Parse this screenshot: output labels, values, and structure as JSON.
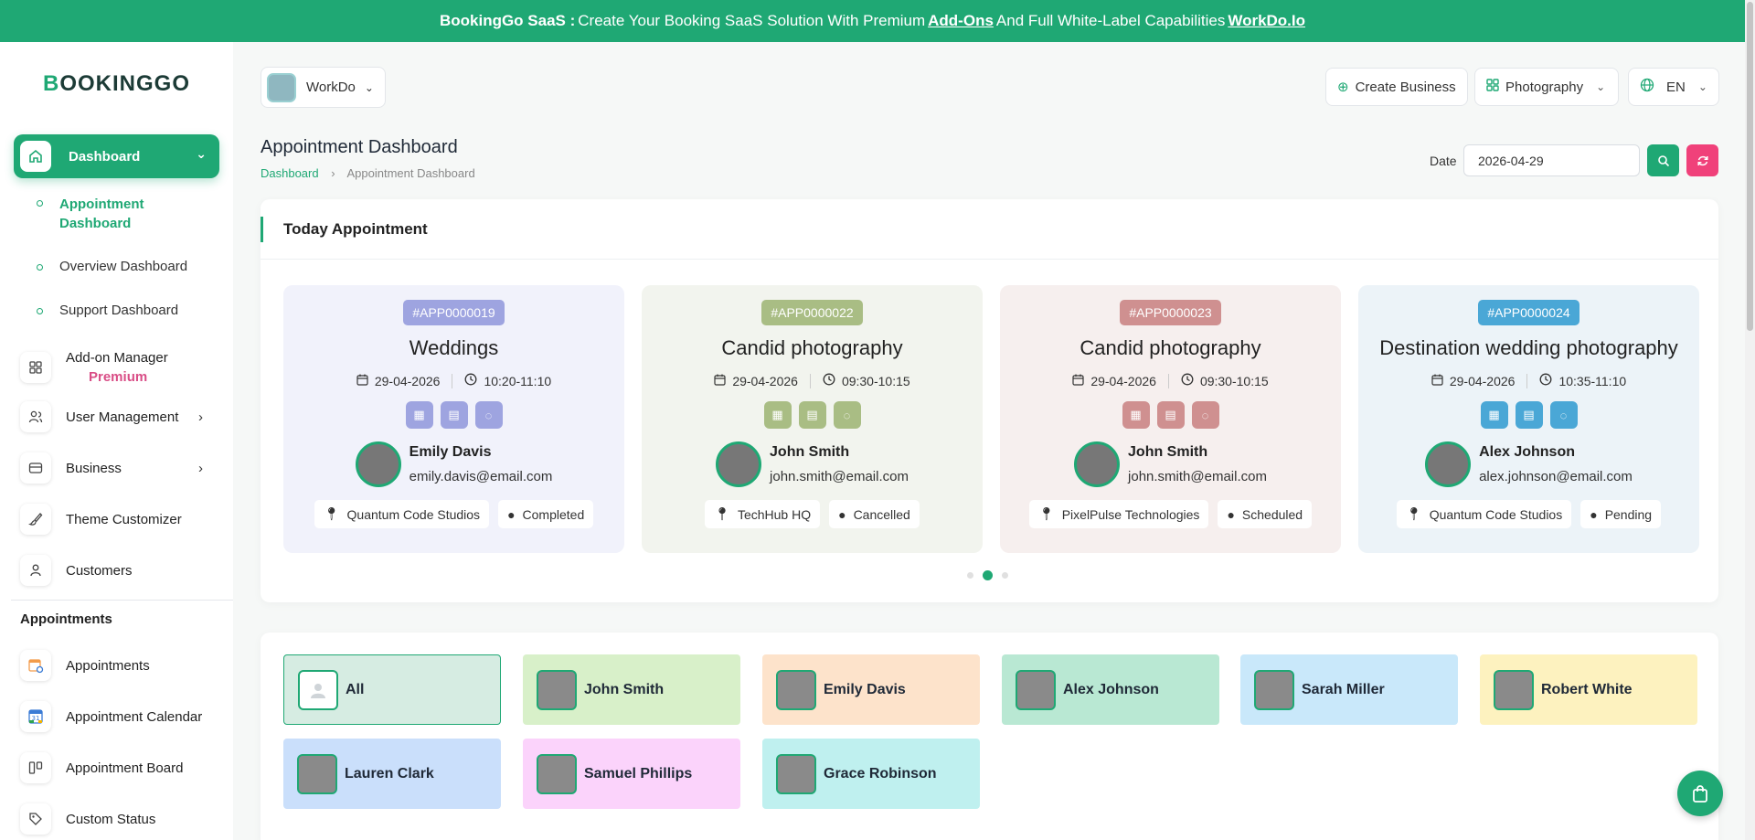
{
  "banner": {
    "brand": "BookingGo SaaS :",
    "text1": "Create Your Booking SaaS Solution With Premium",
    "link1": "Add-Ons",
    "text2": "And Full White-Label Capabilities",
    "link2": "WorkDo.Io"
  },
  "logo": {
    "first": "B",
    "rest": "OOKINGGO"
  },
  "sidebar": {
    "dashboard_label": "Dashboard",
    "sub_items": [
      "Appointment Dashboard",
      "Overview Dashboard",
      "Support Dashboard"
    ],
    "items": [
      {
        "label": "Add-on Manager",
        "badge": "Premium",
        "icon": "grid-icon"
      },
      {
        "label": "User Management",
        "icon": "users-icon"
      },
      {
        "label": "Business",
        "icon": "business-icon"
      },
      {
        "label": "Theme Customizer",
        "icon": "brush-icon"
      },
      {
        "label": "Customers",
        "icon": "user-icon"
      }
    ],
    "section": "Appointments",
    "appointment_items": [
      {
        "label": "Appointments",
        "icon": "appointments-icon"
      },
      {
        "label": "Appointment Calendar",
        "icon": "calendar-icon"
      },
      {
        "label": "Appointment Board",
        "icon": "board-icon"
      },
      {
        "label": "Custom Status",
        "icon": "tag-icon"
      }
    ]
  },
  "header": {
    "workspace": "WorkDo",
    "create_business": "Create Business",
    "category": "Photography",
    "language": "EN"
  },
  "page": {
    "title": "Appointment Dashboard",
    "breadcrumb": [
      "Dashboard",
      "Appointment Dashboard"
    ],
    "date_label": "Date",
    "date_value": "2026-04-29"
  },
  "today": {
    "title": "Today Appointment",
    "cards": [
      {
        "code": "#APP0000019",
        "service": "Weddings",
        "date": "29-04-2026",
        "time": "10:20-11:10",
        "name": "Emily Davis",
        "email": "emily.davis@email.com",
        "business": "Quantum Code Studios",
        "status": "Completed",
        "accent": "#9ea4e0",
        "bg": "#f1f2fb"
      },
      {
        "code": "#APP0000022",
        "service": "Candid photography",
        "date": "29-04-2026",
        "time": "09:30-10:15",
        "name": "John Smith",
        "email": "john.smith@email.com",
        "business": "TechHub HQ",
        "status": "Cancelled",
        "accent": "#a9bd84",
        "bg": "#f2f4ee"
      },
      {
        "code": "#APP0000023",
        "service": "Candid photography",
        "date": "29-04-2026",
        "time": "09:30-10:15",
        "name": "John Smith",
        "email": "john.smith@email.com",
        "business": "PixelPulse Technologies",
        "status": "Scheduled",
        "accent": "#cf9090",
        "bg": "#f6efee"
      },
      {
        "code": "#APP0000024",
        "service": "Destination wedding photography",
        "date": "29-04-2026",
        "time": "10:35-11:10",
        "name": "Alex Johnson",
        "email": "alex.johnson@email.com",
        "business": "Quantum Code Studios",
        "status": "Pending",
        "accent": "#4aa7d6",
        "bg": "#ecf3f8"
      }
    ]
  },
  "staff": [
    {
      "name": "All",
      "bg": "#d6ece2"
    },
    {
      "name": "John Smith",
      "bg": "#d8f0c9"
    },
    {
      "name": "Emily Davis",
      "bg": "#fde3cb"
    },
    {
      "name": "Alex Johnson",
      "bg": "#b9e8d3"
    },
    {
      "name": "Sarah Miller",
      "bg": "#c9e8fa"
    },
    {
      "name": "Robert White",
      "bg": "#fdf2bf"
    },
    {
      "name": "Lauren Clark",
      "bg": "#cadffb"
    },
    {
      "name": "Samuel Phillips",
      "bg": "#fbd3fb"
    },
    {
      "name": "Grace Robinson",
      "bg": "#bff0ef"
    }
  ],
  "colors": {
    "accent": "#1fa874",
    "danger": "#f0417a",
    "premium": "#d94d86"
  }
}
